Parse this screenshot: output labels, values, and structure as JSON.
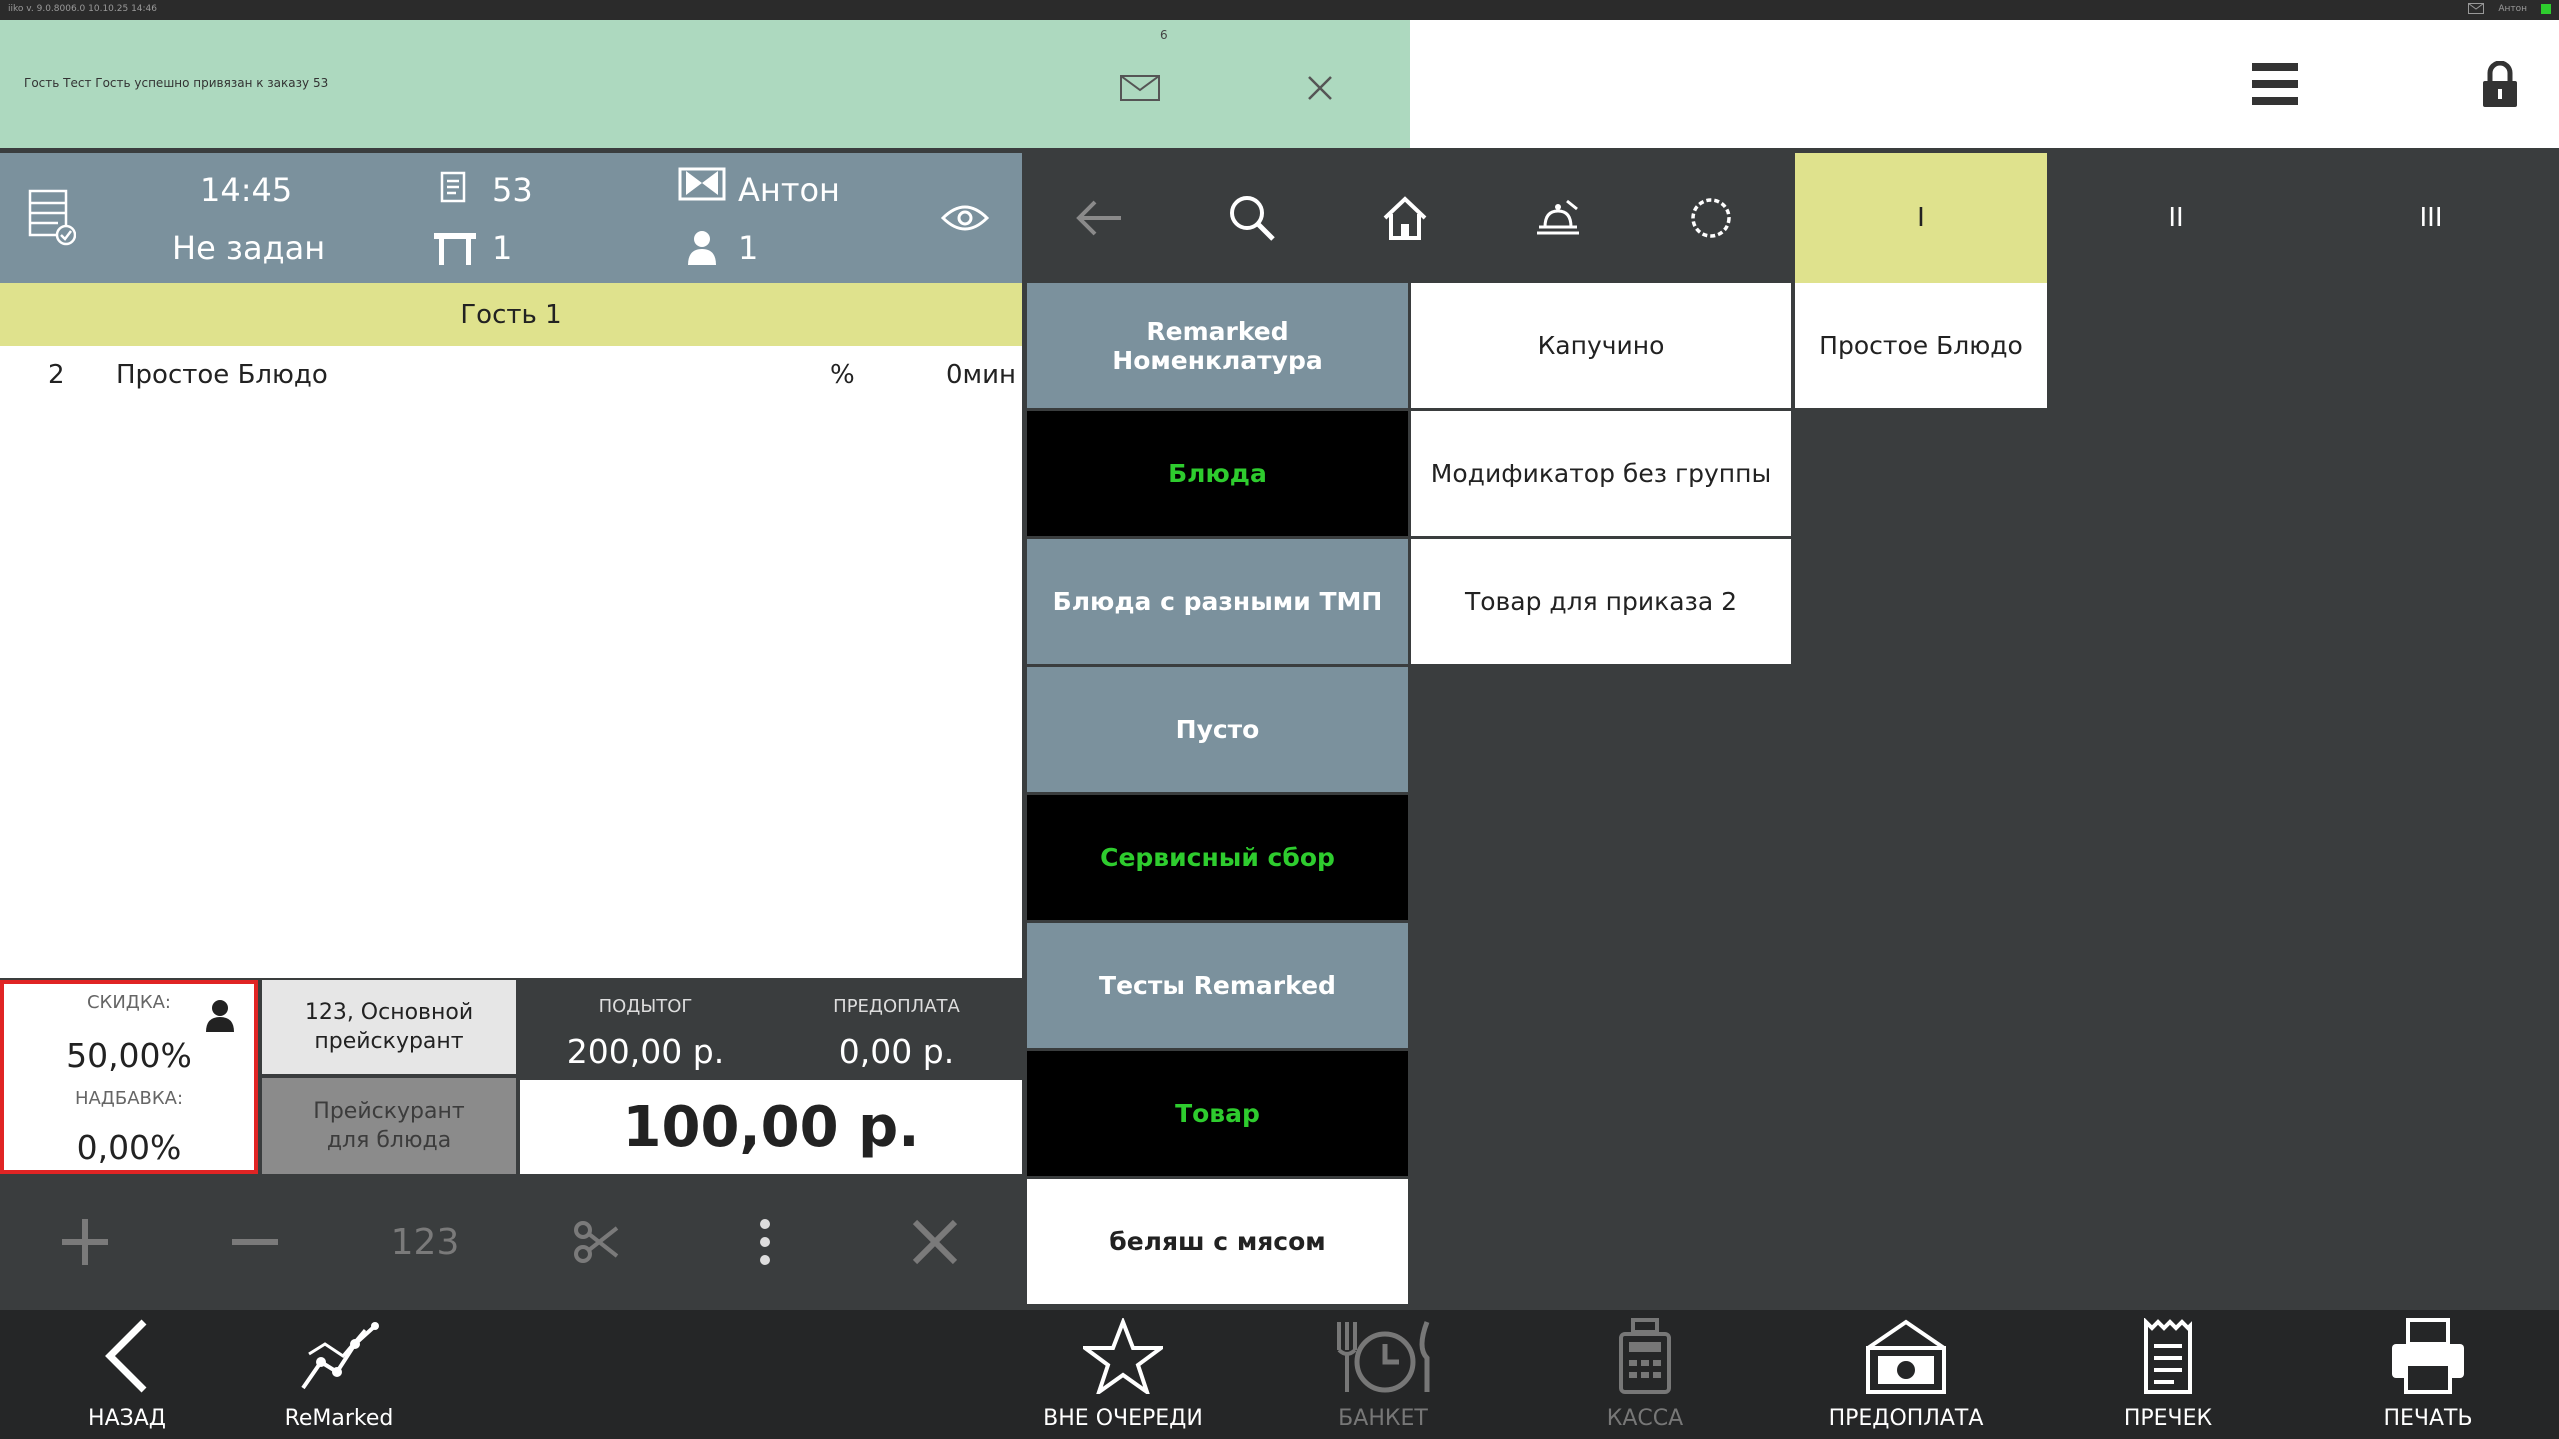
{
  "system": {
    "left_text": "iiko  v. 9.0.8006.0     10.10.25   14:46",
    "user": "Антон"
  },
  "notification": {
    "message": "Гость Тест Гость успешно привязан к заказу 53",
    "count": "6"
  },
  "order_header": {
    "time": "14:45",
    "order_number": "53",
    "waiter": "Антон",
    "status": "Не задан",
    "table": "1",
    "guests": "1"
  },
  "guest_label": "Гость 1",
  "order_items": [
    {
      "qty": "2",
      "name": "Простое Блюдо",
      "percent": "%",
      "time": "0мин"
    }
  ],
  "totals": {
    "discount_label": "СКИДКА:",
    "discount_value": "50,00%",
    "surcharge_label": "НАДБАВКА:",
    "surcharge_value": "0,00%",
    "pricelist_line1": "123, Основной",
    "pricelist_line2": "прейскурант",
    "dish_pricelist_line1": "Прейскурант",
    "dish_pricelist_line2": "для блюда",
    "subtotal_label": "ПОДЫТОГ",
    "subtotal_value": "200,00 р.",
    "prepay_label": "ПРЕДОПЛАТА",
    "prepay_value": "0,00 р.",
    "total_value": "100,00 р."
  },
  "edit_tools": {
    "numpad_label": "123"
  },
  "pages": [
    "I",
    "II",
    "III"
  ],
  "categories": [
    {
      "label": "Remarked Номенклатура",
      "style": "grey"
    },
    {
      "label": "Блюда",
      "style": "black"
    },
    {
      "label": "Блюда с разными ТМП",
      "style": "grey"
    },
    {
      "label": "Пусто",
      "style": "grey"
    },
    {
      "label": "Сервисный сбор",
      "style": "black"
    },
    {
      "label": "Тесты Remarked",
      "style": "grey"
    },
    {
      "label": "Товар",
      "style": "black"
    },
    {
      "label": "беляш с мясом",
      "style": "white"
    }
  ],
  "products": [
    "Капучино",
    "Модификатор без группы",
    "Товар для приказа 2",
    "Простое Блюдо"
  ],
  "bottom_bar": {
    "back": "НАЗАД",
    "remarked": "ReMarked",
    "priority": "ВНЕ ОЧЕРЕДИ",
    "banquet": "БАНКЕТ",
    "cash": "КАССА",
    "prepay": "ПРЕДОПЛАТА",
    "precheck": "ПРЕЧЕК",
    "print": "ПЕЧАТЬ"
  },
  "colors": {
    "header_bg": "#7b919d",
    "accent_yellow": "#dfe28d",
    "notification_green": "#add9bf",
    "category_green_text": "#2ecc2e",
    "discount_border": "#e02424"
  }
}
